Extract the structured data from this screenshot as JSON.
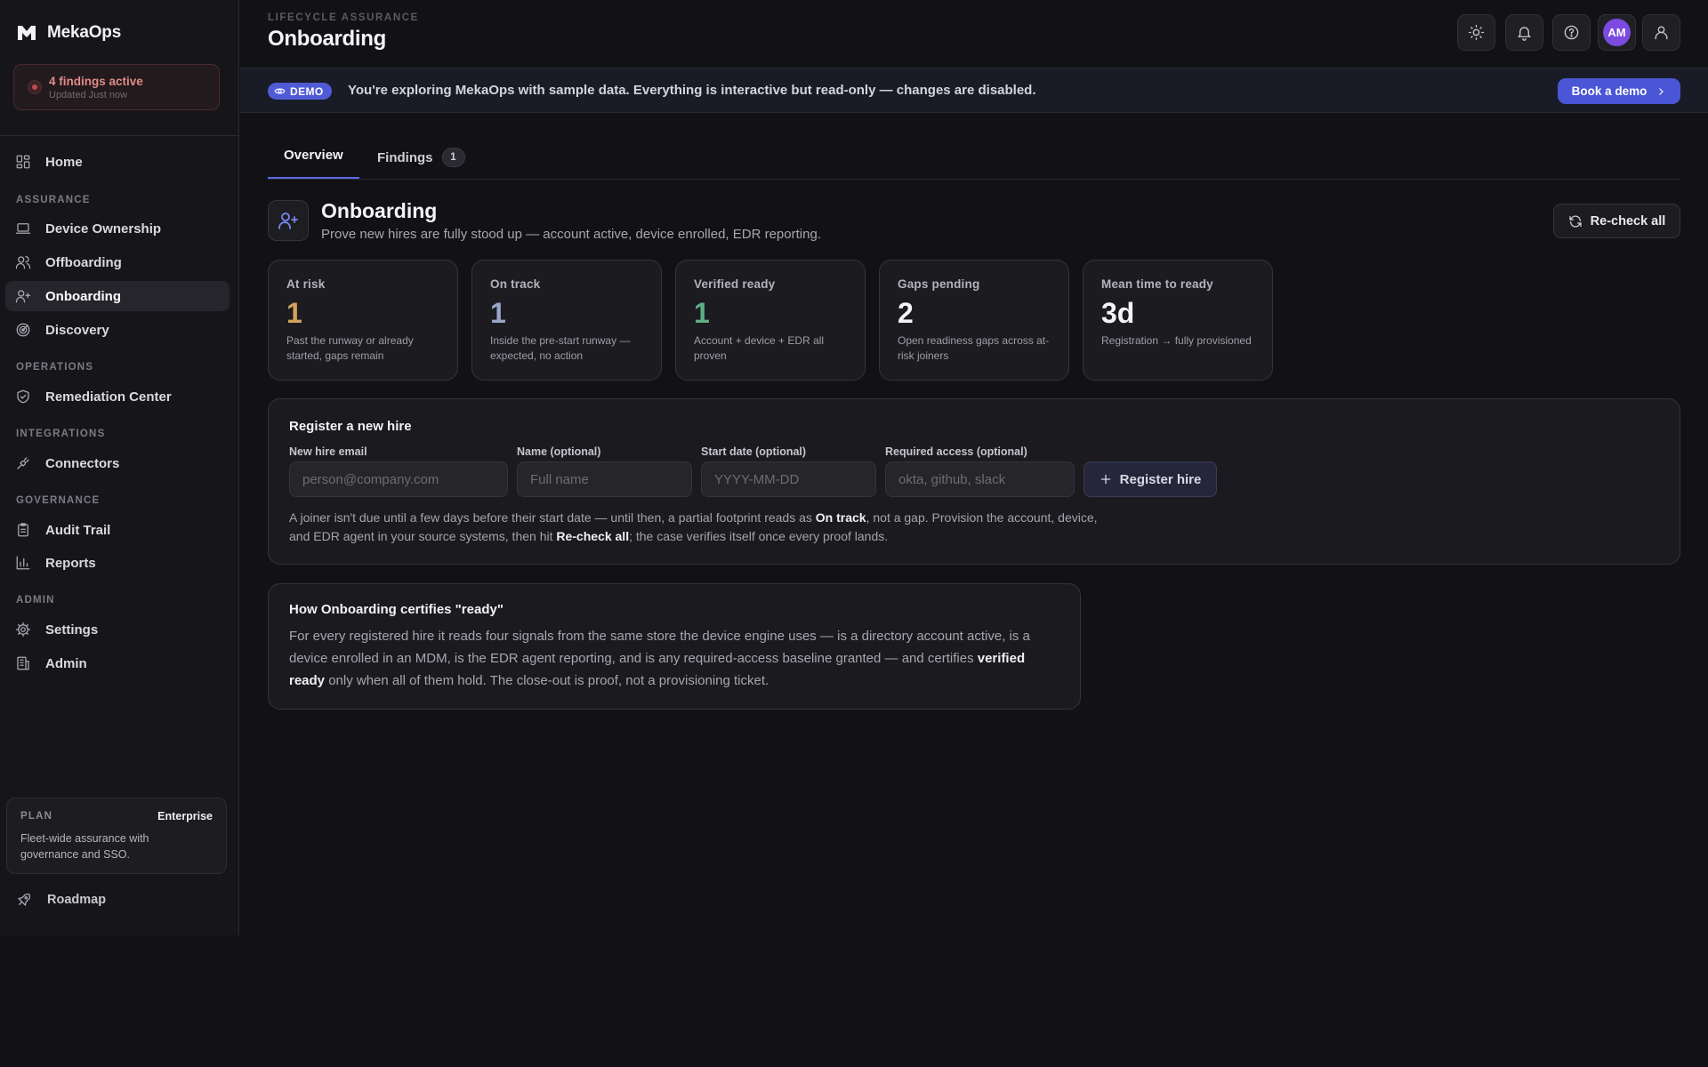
{
  "brand": {
    "name": "MekaOps"
  },
  "findings_status": {
    "title": "4 findings active",
    "updated": "Updated Just now"
  },
  "nav": {
    "home": "Home",
    "sections": {
      "assurance": "ASSURANCE",
      "operations": "OPERATIONS",
      "integrations": "INTEGRATIONS",
      "governance": "GOVERNANCE",
      "admin": "ADMIN"
    },
    "items": {
      "device_ownership": "Device Ownership",
      "offboarding": "Offboarding",
      "onboarding": "Onboarding",
      "discovery": "Discovery",
      "remediation_center": "Remediation Center",
      "connectors": "Connectors",
      "audit_trail": "Audit Trail",
      "reports": "Reports",
      "settings": "Settings",
      "admin": "Admin"
    },
    "active": "onboarding"
  },
  "plan": {
    "label": "PLAN",
    "tier": "Enterprise",
    "description": "Fleet-wide assurance with governance and SSO."
  },
  "roadmap": "Roadmap",
  "header": {
    "eyebrow": "LIFECYCLE ASSURANCE",
    "title": "Onboarding",
    "icons": [
      "sun-icon",
      "bell-icon",
      "help-icon",
      "avatar",
      "user-icon"
    ],
    "avatar_initials": "AM"
  },
  "banner": {
    "pill": "DEMO",
    "text": "You're exploring MekaOps with sample data. Everything is interactive but read-only — changes are disabled.",
    "button": "Book a demo"
  },
  "tabs": {
    "overview": "Overview",
    "findings": "Findings",
    "findings_count": "1",
    "active": "overview"
  },
  "section": {
    "title": "Onboarding",
    "subtitle": "Prove new hires are fully stood up — account active, device enrolled, EDR reporting.",
    "recheck": "Re-check all"
  },
  "stats": [
    {
      "label": "At risk",
      "value": "1",
      "desc": "Past the runway or already started, gaps remain",
      "color": "#d4a25a"
    },
    {
      "label": "On track",
      "value": "1",
      "desc": "Inside the pre-start runway — expected, no action",
      "color": "#9aa6c8"
    },
    {
      "label": "Verified ready",
      "value": "1",
      "desc": "Account + device + EDR all proven",
      "color": "#5fae86"
    },
    {
      "label": "Gaps pending",
      "value": "2",
      "desc": "Open readiness gaps across at-risk joiners",
      "color": "#f4f4f7"
    },
    {
      "label": "Mean time to ready",
      "value": "3d",
      "desc": "Registration → fully provisioned",
      "color": "#f4f4f7"
    }
  ],
  "register": {
    "title": "Register a new hire",
    "email_label": "New hire email",
    "email_placeholder": "person@company.com",
    "name_label": "Name (optional)",
    "name_placeholder": "Full name",
    "date_label": "Start date (optional)",
    "date_placeholder": "YYYY-MM-DD",
    "access_label": "Required access (optional)",
    "access_placeholder": "okta, github, slack",
    "button": "Register hire",
    "note_1": "A joiner isn't due until a few days before their start date — until then, a partial footprint reads as ",
    "note_bold_1": "On track",
    "note_2": ", not a gap. Provision the account, device, and EDR agent in your source systems, then hit ",
    "note_bold_2": "Re-check all",
    "note_3": "; the case verifies itself once every proof lands."
  },
  "how": {
    "title": "How Onboarding certifies \"ready\"",
    "text_1": "For every registered hire it reads four signals from the same store the device engine uses — is a directory account active, is a device enrolled in an MDM, is the EDR agent reporting, and is any required-access baseline granted — and certifies ",
    "text_bold": "verified ready",
    "text_2": " only when all of them hold. The close-out is proof, not a provisioning ticket."
  }
}
